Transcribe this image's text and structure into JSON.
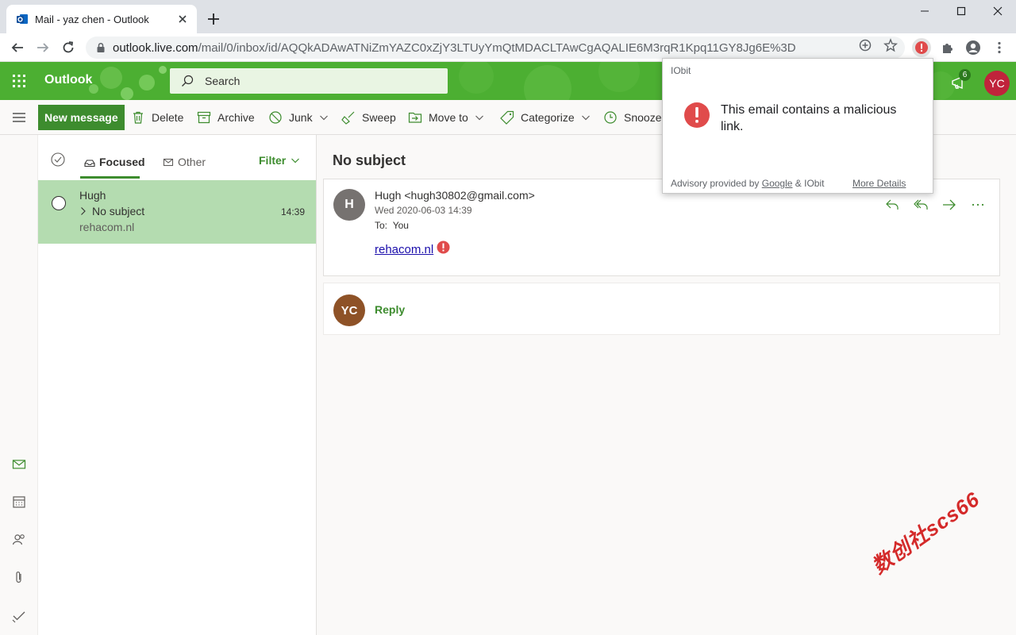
{
  "browser": {
    "tab_title": "Mail - yaz chen - Outlook",
    "url_host": "outlook.live.com",
    "url_path": "/mail/0/inbox/id/AQQkADAwATNiZmYAZC0xZjY3LTUyYmQtMDACLTAwCgAQALIE6M3rqR1Kpq11GY8Jg6E%3D"
  },
  "header": {
    "app_name": "Outlook",
    "search_placeholder": "Search",
    "notification_count": "6",
    "user_initials": "YC"
  },
  "commands": {
    "new_message": "New message",
    "delete": "Delete",
    "archive": "Archive",
    "junk": "Junk",
    "sweep": "Sweep",
    "move_to": "Move to",
    "categorize": "Categorize",
    "snooze": "Snooze"
  },
  "list": {
    "focused_tab": "Focused",
    "other_tab": "Other",
    "filter_label": "Filter",
    "messages": [
      {
        "sender": "Hugh",
        "subject": "No subject",
        "time": "14:39",
        "preview": "rehacom.nl"
      }
    ]
  },
  "reading": {
    "subject": "No subject",
    "from": "Hugh <hugh30802@gmail.com>",
    "date": "Wed 2020-06-03 14:39",
    "to_label": "To:",
    "to_value": "You",
    "sender_initial": "H",
    "body_link": "rehacom.nl",
    "reply_initials": "YC",
    "reply_label": "Reply"
  },
  "popup": {
    "title": "IObit",
    "message": "This email contains a malicious link.",
    "footer_prefix": "Advisory provided by",
    "footer_google": "Google",
    "footer_suffix": "& IObit",
    "more_details": "More Details"
  },
  "watermark": "数创社scs66",
  "colors": {
    "outlook_green": "#4caf32",
    "accent_green": "#3d8c2e",
    "selected_row": "#b4dcb0",
    "warning_red": "#e04b4b",
    "avatar_red": "#c0233b",
    "avatar_brown": "#8e5227"
  }
}
